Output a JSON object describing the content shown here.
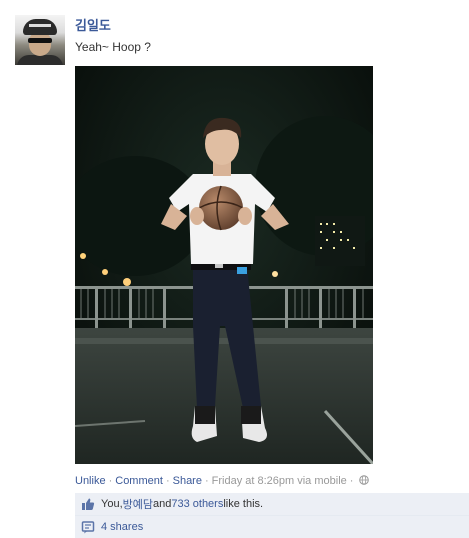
{
  "post": {
    "author": "김일도",
    "text": "Yeah~ Hoop ?",
    "photo_icon": "photo-basketball-night"
  },
  "actions": {
    "unlike": "Unlike",
    "comment": "Comment",
    "share": "Share",
    "sep": "·",
    "timestamp": "Friday at 8:26pm via mobile",
    "privacy_icon": "globe-icon"
  },
  "likes": {
    "icon": "thumbs-up-icon",
    "you": "You, ",
    "friend": "방예담",
    "and": " and ",
    "others": "733 others",
    "suffix": " like this."
  },
  "shares": {
    "icon": "share-icon",
    "label": "4 shares"
  },
  "colors": {
    "link": "#3b5998",
    "bar_bg": "#eceff5",
    "muted": "#999999"
  }
}
